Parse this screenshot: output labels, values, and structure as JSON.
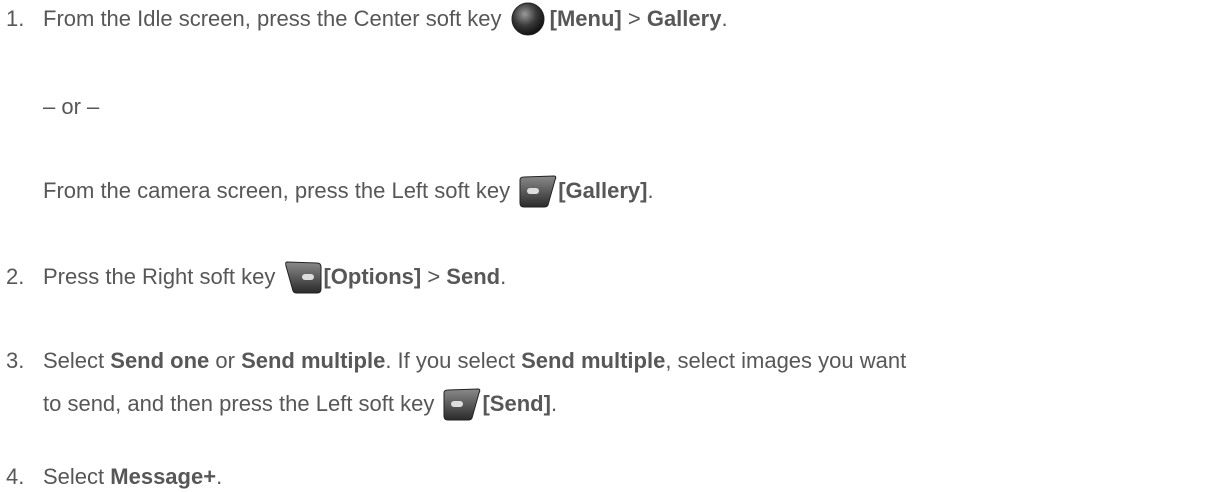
{
  "steps": {
    "s1": {
      "num": "1.",
      "pre": "From the Idle screen, press the Center soft key",
      "key_label": "[Menu]",
      "sep": " > ",
      "target": "Gallery",
      "end": ".",
      "icon": "center-soft-key-icon"
    },
    "or": "– or –",
    "s1b": {
      "pre": "From the camera screen, press the Left soft key",
      "key_label": "[Gallery]",
      "end": ".",
      "icon": "left-soft-key-icon"
    },
    "s2": {
      "num": "2.",
      "pre": "Press the Right soft key",
      "key_label": "[Options]",
      "sep": " > ",
      "target": "Send",
      "end": ".",
      "icon": "right-soft-key-icon"
    },
    "s3": {
      "num": "3.",
      "pre": "Select ",
      "opt1": "Send one",
      "mid": " or ",
      "opt2": "Send multiple",
      "mid2": ". If you select ",
      "opt3": "Send multiple",
      "mid3": ", select images you want",
      "line2_pre": "to send, and then press the Left soft key",
      "key_label": "[Send]",
      "end": ".",
      "icon": "left-soft-key-icon"
    },
    "s4": {
      "num": "4.",
      "pre": "Select ",
      "target": "Message+",
      "end": "."
    }
  }
}
